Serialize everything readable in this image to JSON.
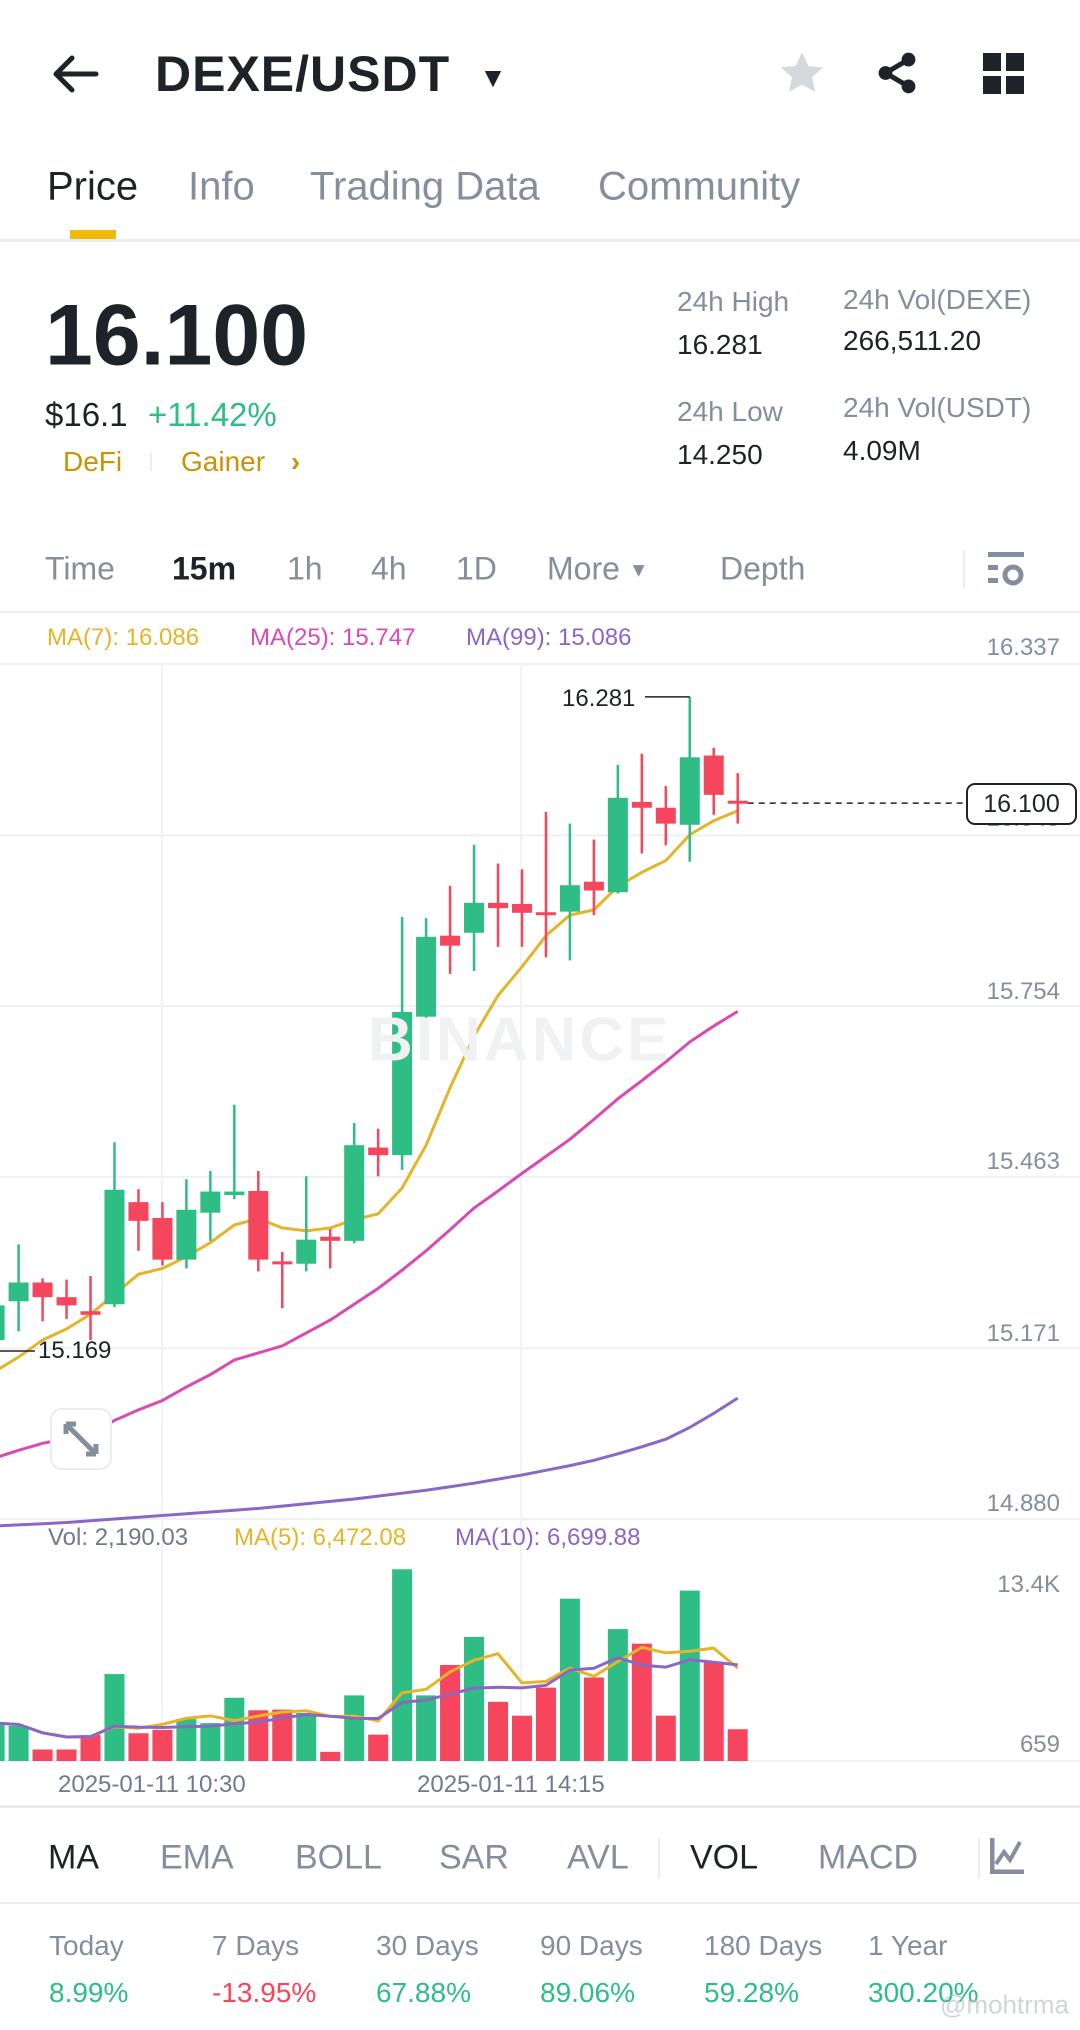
{
  "header": {
    "title": "DEXE/USDT"
  },
  "tabs": [
    {
      "label": "Price"
    },
    {
      "label": "Info"
    },
    {
      "label": "Trading Data"
    },
    {
      "label": "Community"
    }
  ],
  "price": {
    "last": "16.100",
    "usd": "$16.1",
    "change": "+11.42%",
    "tag1": "DeFi",
    "tag2": "Gainer"
  },
  "stats": {
    "high_label": "24h High",
    "high": "16.281",
    "low_label": "24h Low",
    "low": "14.250",
    "vol_base_label": "24h Vol(DEXE)",
    "vol_base": "266,511.20",
    "vol_quote_label": "24h Vol(USDT)",
    "vol_quote": "4.09M"
  },
  "timeframes": {
    "items": [
      "Time",
      "15m",
      "1h",
      "4h",
      "1D",
      "More"
    ],
    "active": "15m",
    "depth": "Depth"
  },
  "legend": {
    "ma7": "MA(7): 16.086",
    "ma25": "MA(25): 15.747",
    "ma99": "MA(99): 15.086"
  },
  "vol_legend": {
    "vol": "Vol: 2,190.03",
    "ma5": "MA(5): 6,472.08",
    "ma10": "MA(10): 6,699.88"
  },
  "colors": {
    "up": "#2EBD85",
    "down": "#F6465D",
    "ma7": "#E5B428",
    "ma25": "#D84BB5",
    "ma99": "#8C66C4",
    "accent": "#F0B90B"
  },
  "chart_data": {
    "type": "candlestick",
    "interval": "15m",
    "price_axis": {
      "ticks": [
        "16.337",
        "16.045",
        "15.754",
        "15.463",
        "15.171",
        "14.880"
      ],
      "range": [
        14.88,
        16.337
      ]
    },
    "volume_axis": {
      "ticks": [
        "13.4K",
        "659"
      ]
    },
    "x_labels": [
      "2025-01-11 10:30",
      "2025-01-11 14:15"
    ],
    "current_price": "16.100",
    "high_marker": "16.281",
    "low_marker": "15.169",
    "ohlc": [
      [
        15.185,
        15.244,
        15.248,
        15.18
      ],
      [
        15.251,
        15.283,
        15.348,
        15.2
      ],
      [
        15.283,
        15.258,
        15.29,
        15.217
      ],
      [
        15.258,
        15.244,
        15.288,
        15.221
      ],
      [
        15.234,
        15.228,
        15.294,
        15.185
      ],
      [
        15.246,
        15.441,
        15.522,
        15.241
      ],
      [
        15.42,
        15.388,
        15.442,
        15.337
      ],
      [
        15.393,
        15.322,
        15.42,
        15.312
      ],
      [
        15.322,
        15.407,
        15.459,
        15.307
      ],
      [
        15.402,
        15.438,
        15.473,
        15.354
      ],
      [
        15.432,
        15.438,
        15.586,
        15.425
      ],
      [
        15.439,
        15.322,
        15.473,
        15.302
      ],
      [
        15.319,
        15.314,
        15.335,
        15.239
      ],
      [
        15.315,
        15.356,
        15.464,
        15.302
      ],
      [
        15.361,
        15.354,
        15.374,
        15.307
      ],
      [
        15.354,
        15.517,
        15.555,
        15.35
      ],
      [
        15.513,
        15.5,
        15.545,
        15.464
      ],
      [
        15.5,
        15.744,
        15.906,
        15.475
      ],
      [
        15.736,
        15.872,
        15.904,
        15.679
      ],
      [
        15.874,
        15.857,
        15.959,
        15.809
      ],
      [
        15.879,
        15.93,
        16.029,
        15.814
      ],
      [
        15.93,
        15.921,
        15.997,
        15.855
      ],
      [
        15.928,
        15.913,
        15.987,
        15.855
      ],
      [
        15.914,
        15.909,
        16.085,
        15.837
      ],
      [
        15.915,
        15.96,
        16.065,
        15.832
      ],
      [
        15.966,
        15.951,
        16.038,
        15.909
      ],
      [
        15.948,
        16.109,
        16.165,
        15.946
      ],
      [
        16.102,
        16.092,
        16.184,
        16.014
      ],
      [
        16.092,
        16.065,
        16.129,
        16.028
      ],
      [
        16.063,
        16.178,
        16.281,
        16.0
      ],
      [
        16.181,
        16.114,
        16.194,
        16.08
      ],
      [
        16.104,
        16.1,
        16.151,
        16.065
      ]
    ],
    "ma7": [
      15.131,
      15.156,
      15.185,
      15.204,
      15.229,
      15.263,
      15.297,
      15.307,
      15.327,
      15.351,
      15.381,
      15.392,
      15.376,
      15.371,
      15.376,
      15.39,
      15.4,
      15.444,
      15.517,
      15.615,
      15.703,
      15.772,
      15.821,
      15.874,
      15.909,
      15.918,
      15.958,
      15.982,
      16.002,
      16.046,
      16.07,
      16.087
    ],
    "ma25": [
      14.984,
      14.997,
      15.009,
      15.017,
      15.024,
      15.048,
      15.066,
      15.082,
      15.105,
      15.126,
      15.151,
      15.163,
      15.175,
      15.197,
      15.219,
      15.246,
      15.273,
      15.304,
      15.337,
      15.373,
      15.41,
      15.439,
      15.469,
      15.498,
      15.527,
      15.561,
      15.596,
      15.627,
      15.659,
      15.693,
      15.72,
      15.745
    ],
    "ma99": [
      14.868,
      14.87,
      14.872,
      14.874,
      14.877,
      14.88,
      14.883,
      14.886,
      14.889,
      14.892,
      14.895,
      14.898,
      14.902,
      14.906,
      14.91,
      14.914,
      14.919,
      14.924,
      14.929,
      14.935,
      14.941,
      14.948,
      14.955,
      14.963,
      14.971,
      14.98,
      14.991,
      15.003,
      15.016,
      15.036,
      15.06,
      15.086
    ],
    "volume": [
      2610,
      2423,
      792,
      792,
      1794,
      5988,
      1911,
      2144,
      2889,
      2610,
      4357,
      3495,
      3542,
      3309,
      629,
      4520,
      1817,
      13211,
      4520,
      6617,
      8551,
      4078,
      3122,
      5056,
      11184,
      5755,
      9087,
      8085,
      3122,
      11743,
      6850,
      2190
    ]
  },
  "indicators": {
    "main": [
      "MA",
      "EMA",
      "BOLL",
      "SAR",
      "AVL"
    ],
    "sub": [
      "VOL",
      "MACD"
    ],
    "active_main": "MA",
    "active_sub": "VOL"
  },
  "periods": [
    {
      "label": "Today",
      "value": "8.99%",
      "dir": "up"
    },
    {
      "label": "7 Days",
      "value": "-13.95%",
      "dir": "down"
    },
    {
      "label": "30 Days",
      "value": "67.88%",
      "dir": "up"
    },
    {
      "label": "90 Days",
      "value": "89.06%",
      "dir": "up"
    },
    {
      "label": "180 Days",
      "value": "59.28%",
      "dir": "up"
    },
    {
      "label": "1 Year",
      "value": "300.20%",
      "dir": "up"
    }
  ],
  "watermark": "BINANCE",
  "user_watermark": "@mohtrma"
}
